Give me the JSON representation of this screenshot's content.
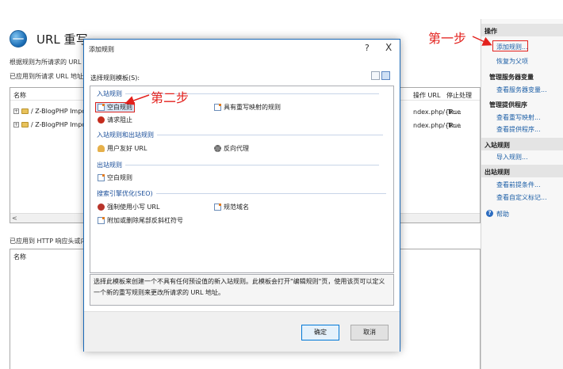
{
  "page": {
    "title": "URL 重写",
    "desc1": "根据规则为所请求的 URL 地址",
    "desc2": "已应用到所请求 URL 地址的",
    "grid1": {
      "headers": [
        "名称",
        "操作 URL",
        "停止处理"
      ],
      "rows": [
        {
          "name": "/ Z-BlogPHP Impor",
          "url": "ndex.php/{R:...",
          "stop": "True"
        },
        {
          "name": "/ Z-BlogPHP Impor",
          "url": "ndex.php/{R:...",
          "stop": "True"
        }
      ],
      "scroll_left": "<"
    },
    "http_label": "已应用到 HTTP 响应头或内容",
    "grid2": {
      "header": "名称"
    }
  },
  "actions": {
    "title": "操作",
    "items": [
      {
        "type": "link",
        "label": "添加规则..."
      },
      {
        "type": "link",
        "label": "恢复为父项"
      },
      {
        "type": "sub",
        "label": "管理服务器变量"
      },
      {
        "type": "link",
        "label": "查看服务器变量..."
      },
      {
        "type": "sub",
        "label": "管理提供程序"
      },
      {
        "type": "link",
        "label": "查看重写映射..."
      },
      {
        "type": "link",
        "label": "查看提供程序..."
      },
      {
        "type": "section",
        "label": "入站规则"
      },
      {
        "type": "link",
        "label": "导入规则..."
      },
      {
        "type": "section",
        "label": "出站规则"
      },
      {
        "type": "link",
        "label": "查看前提条件..."
      },
      {
        "type": "link",
        "label": "查看自定义标记..."
      },
      {
        "type": "help",
        "label": "帮助"
      }
    ]
  },
  "dialog": {
    "title": "添加规则",
    "help": "?",
    "close": "X",
    "select_label": "选择规则模板(S):",
    "groups": [
      {
        "name": "入站规则",
        "items": [
          "空白规则",
          "具有重写映射的规则",
          "请求阻止"
        ]
      },
      {
        "name": "入站规则和出站规则",
        "items": [
          "用户友好 URL",
          "反向代理"
        ]
      },
      {
        "name": "出站规则",
        "items": [
          "空白规则"
        ]
      },
      {
        "name": "搜索引擎优化(SEO)",
        "items": [
          "强制使用小写 URL",
          "规范域名",
          "附加或删除尾部反斜杠符号"
        ]
      }
    ],
    "description": "选择此模板来创建一个不具有任何预设值的新入站规则。此模板会打开\"编辑规则\"页，使用该页可以定义一个新的重写规则来更改所请求的 URL 地址。",
    "ok": "确定",
    "cancel": "取消"
  },
  "annotations": {
    "step1": "第一步",
    "step2": "第二步",
    "color": "#e3211d"
  }
}
